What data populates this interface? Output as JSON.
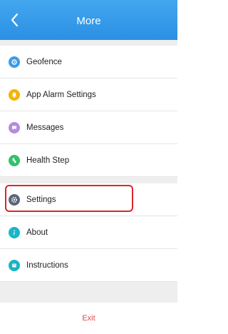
{
  "header": {
    "title": "More",
    "back_icon": "chevron-left-icon",
    "color": "#3a9eed"
  },
  "menu": {
    "group1": [
      {
        "label": "Geofence",
        "icon": "geofence-icon",
        "color": "#3b9be8"
      },
      {
        "label": "App Alarm Settings",
        "icon": "alarm-bell-icon",
        "color": "#f4b400"
      },
      {
        "label": "Messages",
        "icon": "messages-icon",
        "color": "#b58be0"
      },
      {
        "label": "Health Step",
        "icon": "health-step-icon",
        "color": "#34c06b"
      }
    ],
    "group2": [
      {
        "label": "Settings",
        "icon": "gear-icon",
        "color": "#5a6677"
      },
      {
        "label": "About",
        "icon": "info-icon",
        "color": "#17b6c9"
      },
      {
        "label": "Instructions",
        "icon": "instructions-icon",
        "color": "#19b4c2"
      }
    ]
  },
  "exit": {
    "label": "Exit",
    "color": "#e04b4b"
  },
  "highlight_color": "#d9262e"
}
